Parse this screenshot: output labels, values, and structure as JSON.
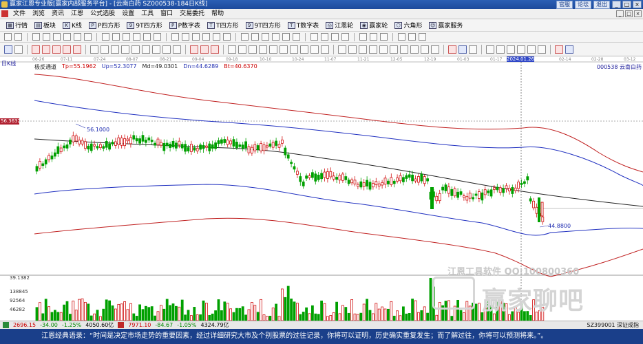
{
  "window": {
    "title": "赢家江恩专业版[赢家内部服务平台] - [云南白药   SZ000538-184日K线]",
    "links": [
      "官服",
      "论坛",
      "退出"
    ],
    "controls": [
      "_",
      "□",
      "×"
    ]
  },
  "menubar": {
    "items": [
      "文件",
      "浏览",
      "资讯",
      "江恩",
      "公式选股",
      "设置",
      "工具",
      "窗口",
      "交易委托",
      "帮助"
    ]
  },
  "toolbar1": {
    "items": [
      "行情",
      "板块",
      "K线",
      "P四方形",
      "9T四方形",
      "P数字表",
      "T四方形",
      "9T四方形",
      "T数字表",
      "江恩轮",
      "赢家轮",
      "六角形",
      "赢家服务"
    ]
  },
  "chart": {
    "period_label": "日K线",
    "indicator_name": "极反通道",
    "tp": "Tp=55.1962",
    "up": "Up=52.3077",
    "md": "Md=49.0301",
    "dn": "Dn=44.6289",
    "bt": "Bt=40.6370",
    "stock": "000538  云南白药",
    "dates": [
      "06-26",
      "07-11",
      "07-24",
      "08-07",
      "08-21",
      "09-04",
      "09-18",
      "10-10",
      "10-24",
      "11-07",
      "11-21",
      "12-05",
      "12-19",
      "01-03",
      "01-17",
      "2024.01.26",
      "02-14",
      "02-28",
      "03-12"
    ],
    "price_tag": "56.3632",
    "high_mark": "56.1000",
    "low_mark": "44.8800",
    "vol_labels": [
      "39.1382",
      "138845",
      "92564",
      "46282"
    ],
    "colors": {
      "up": "#d01010",
      "down": "#00a000",
      "upper_band": "#c02020",
      "lower_band": "#2030c0",
      "mid": "#202020"
    }
  },
  "watermark": {
    "line1": "江恩工具软件 QQ:100800360",
    "line2": "赢家聊吧"
  },
  "index_bar": {
    "sh": "2696.15",
    "sh_change": "-34.00",
    "sh_pct": "-1.25%",
    "sh_amount": "4050.60亿",
    "sz": "7971.10",
    "sz_change": "-84.67",
    "sz_pct": "-1.05%",
    "sz_amount": "4324.79亿",
    "right": "SZ399001 深证成指"
  },
  "quote": {
    "text": "江恩经典语录：“时间是决定市场走势的重要因素，经过详细研究大市及个别股票的过往记录，你将可以证明，历史确实重复发生；而了解过往，你将可以预测将来。”。"
  }
}
